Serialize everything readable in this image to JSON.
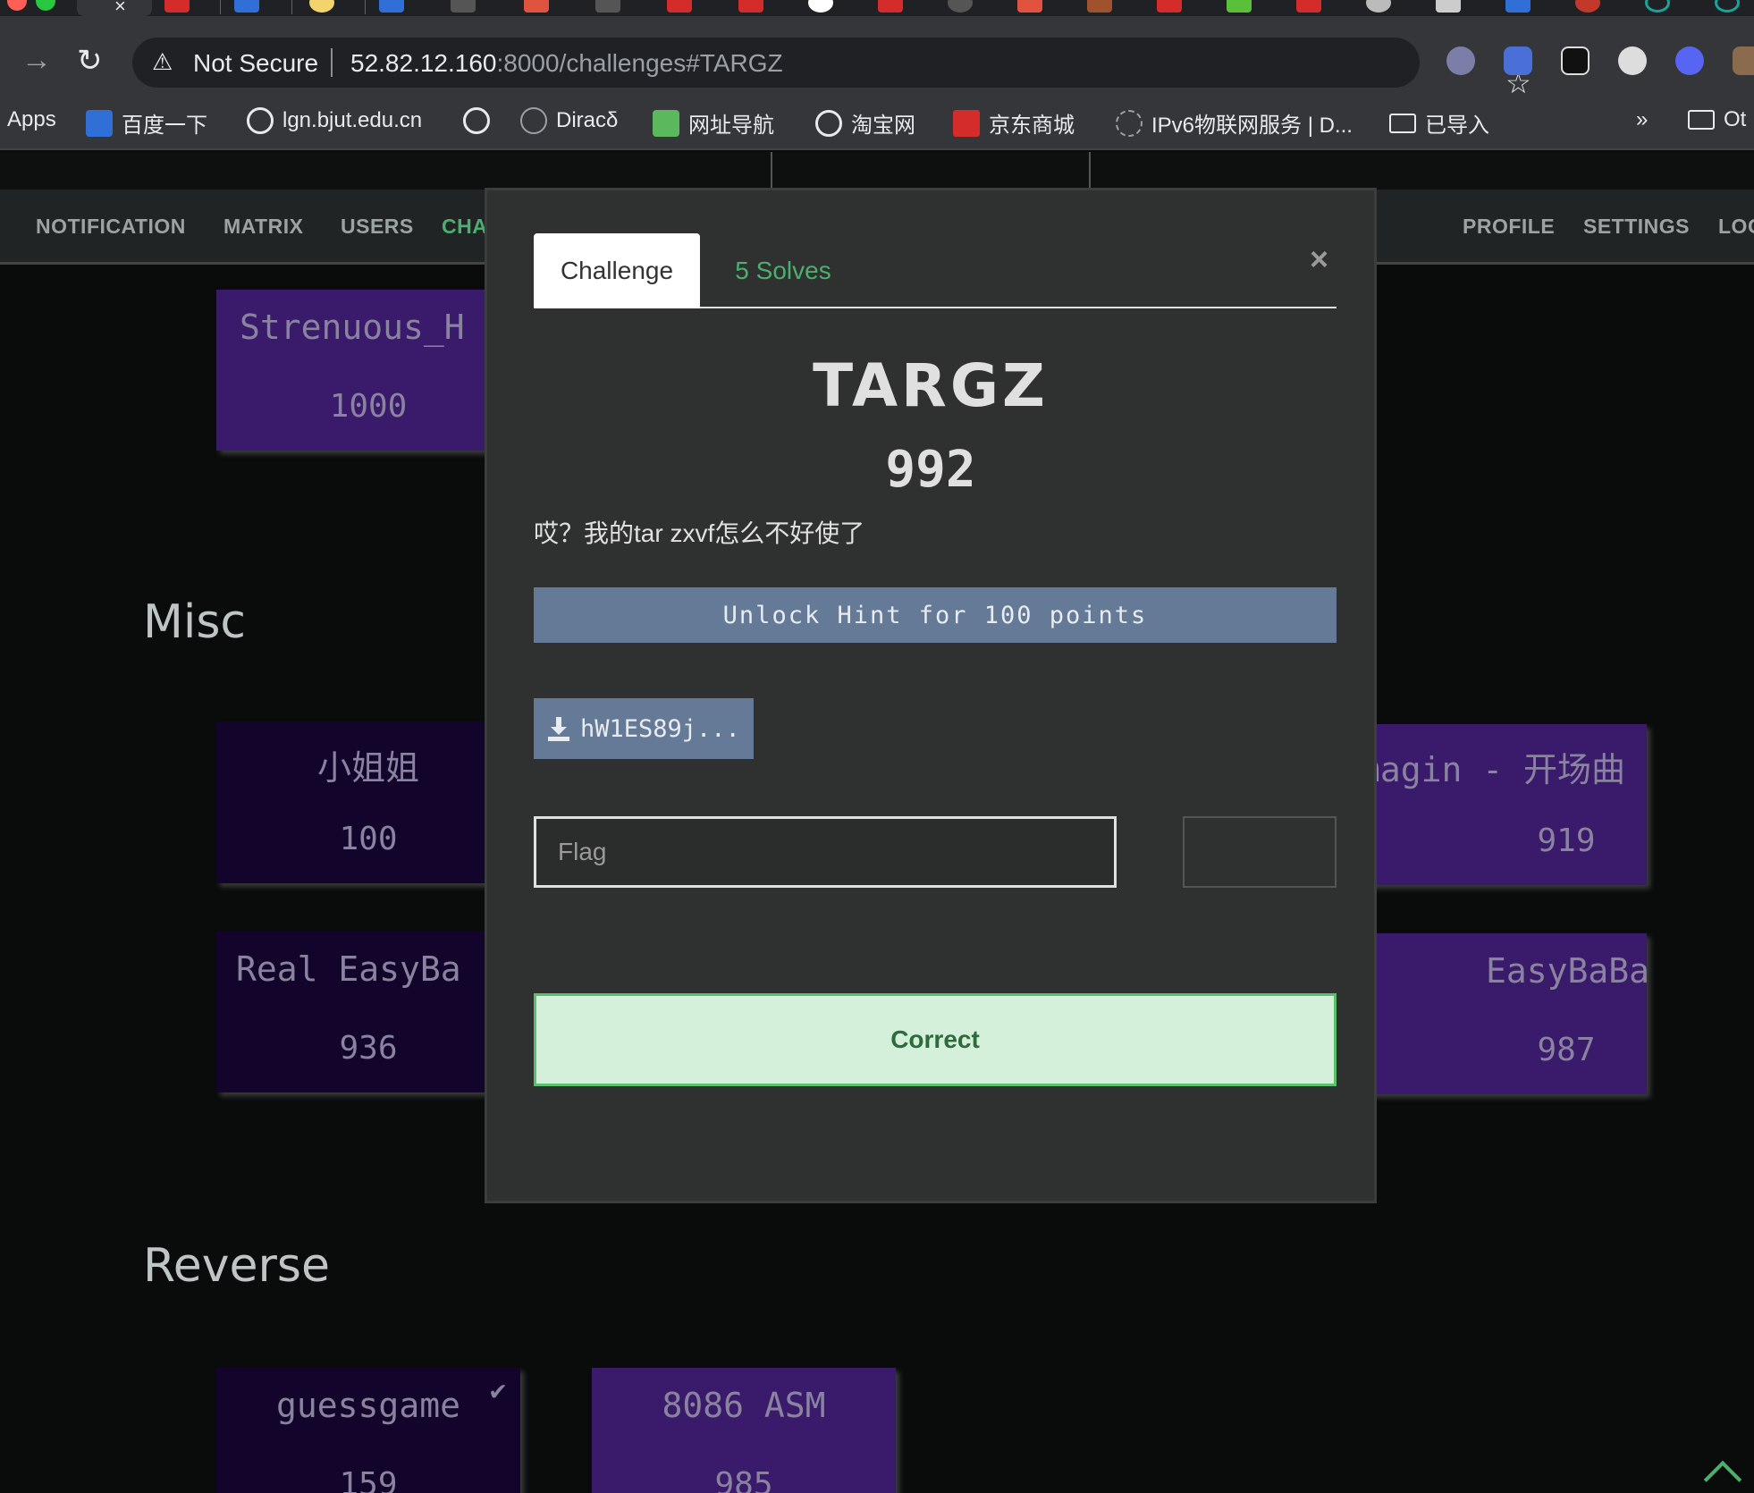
{
  "browser": {
    "address": {
      "security_label": "Not Secure",
      "url_host": "52.82.12.160",
      "url_path": ":8000/challenges#TARGZ"
    },
    "bookmarks": [
      {
        "label": "Apps",
        "icon": "apps-grid-icon"
      },
      {
        "label": "百度一下",
        "icon": "baidu-icon"
      },
      {
        "label": "lgn.bjut.edu.cn",
        "icon": "globe-icon"
      },
      {
        "label": "",
        "icon": "globe-icon"
      },
      {
        "label": "Diracδ",
        "icon": "user-avatar-icon"
      },
      {
        "label": "网址导航",
        "icon": "hao-icon"
      },
      {
        "label": "淘宝网",
        "icon": "globe-icon"
      },
      {
        "label": "京东商城",
        "icon": "jd-icon"
      },
      {
        "label": "IPv6物联网服务 | D...",
        "icon": "ipv6-icon"
      },
      {
        "label": "已导入",
        "icon": "folder-icon"
      },
      {
        "label": "»",
        "icon": ""
      },
      {
        "label": "Ot",
        "icon": "folder-icon"
      }
    ]
  },
  "nav": {
    "left": [
      "NOTIFICATION",
      "MATRIX",
      "USERS",
      "CHA"
    ],
    "right": [
      "PROFILE",
      "SETTINGS",
      "LOG"
    ]
  },
  "sections": {
    "misc_title": "Misc",
    "reverse_title": "Reverse"
  },
  "cards": {
    "strenuous": {
      "name": "Strenuous_H",
      "value": "1000"
    },
    "xiaojiejie": {
      "name": "小姐姐",
      "value": "100"
    },
    "real_easybaba": {
      "name": "Real EasyBa",
      "value": "936"
    },
    "magin": {
      "name": "magin - 开场曲",
      "value": "919"
    },
    "easybaba": {
      "name": "EasyBaBa",
      "value": "987"
    },
    "guessgame": {
      "name": "guessgame",
      "value": "159"
    },
    "asm8086": {
      "name": "8086 ASM",
      "value": "985"
    }
  },
  "modal": {
    "tab_challenge": "Challenge",
    "tab_solves": "5 Solves",
    "close": "×",
    "name": "TARGZ",
    "value": "992",
    "description": "哎？我的tar zxvf怎么不好使了",
    "hint_button": "Unlock Hint for 100 points",
    "file_button": "hW1ES89j...",
    "flag_placeholder": "Flag",
    "result": "Correct"
  },
  "colors": {
    "accent_green": "#4caf70",
    "hint_blue": "#657a97",
    "card_purple": "#3a1a6b",
    "card_dark": "#12042a",
    "success_bg": "#d4f0da"
  }
}
